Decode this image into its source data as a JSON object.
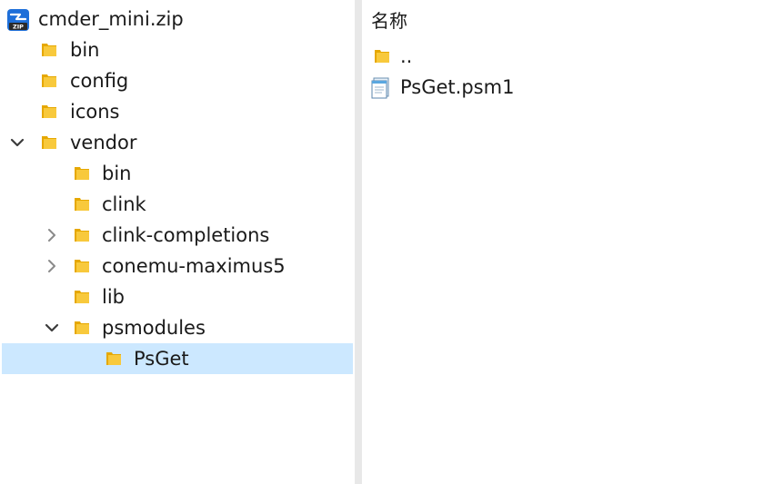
{
  "tree": {
    "root": {
      "label": "cmder_mini.zip",
      "icon": "zip-archive-icon"
    },
    "items": [
      {
        "label": "bin",
        "icon": "folder-icon"
      },
      {
        "label": "config",
        "icon": "folder-icon"
      },
      {
        "label": "icons",
        "icon": "folder-icon"
      },
      {
        "label": "vendor",
        "icon": "folder-icon",
        "expanded": true
      },
      {
        "label": "bin",
        "icon": "folder-icon"
      },
      {
        "label": "clink",
        "icon": "folder-icon"
      },
      {
        "label": "clink-completions",
        "icon": "folder-icon",
        "expanded": false
      },
      {
        "label": "conemu-maximus5",
        "icon": "folder-icon",
        "expanded": false
      },
      {
        "label": "lib",
        "icon": "folder-icon"
      },
      {
        "label": "psmodules",
        "icon": "folder-icon",
        "expanded": true
      },
      {
        "label": "PsGet",
        "icon": "folder-icon",
        "selected": true
      }
    ]
  },
  "list": {
    "column_header": "名称",
    "items": [
      {
        "label": "..",
        "icon": "folder-icon"
      },
      {
        "label": "PsGet.psm1",
        "icon": "notepad-file-icon"
      }
    ]
  },
  "colors": {
    "selection": "#cce8ff",
    "folder": "#f4c542",
    "splitter": "#e8e8e8"
  }
}
